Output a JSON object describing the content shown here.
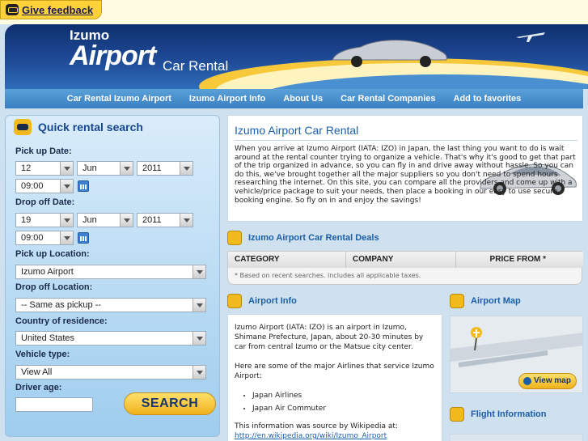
{
  "feedback": {
    "label": "Give feedback"
  },
  "header": {
    "logo_line1": "Izumo",
    "logo_line2": "Airport",
    "logo_line3": "Car Rental"
  },
  "nav": {
    "items": [
      {
        "label": "Car Rental Izumo Airport"
      },
      {
        "label": "Izumo Airport Info"
      },
      {
        "label": "About Us"
      },
      {
        "label": "Car Rental Companies"
      },
      {
        "label": "Add to favorites"
      }
    ]
  },
  "search": {
    "title": "Quick rental search",
    "pickup_date_label": "Pick up Date:",
    "pickup_day": "12",
    "pickup_month": "Jun",
    "pickup_year": "2011",
    "pickup_time": "09:00",
    "dropoff_date_label": "Drop off Date:",
    "dropoff_day": "19",
    "dropoff_month": "Jun",
    "dropoff_year": "2011",
    "dropoff_time": "09:00",
    "pickup_location_label": "Pick up Location:",
    "pickup_location": "Izumo Airport",
    "dropoff_location_label": "Drop off Location:",
    "dropoff_location": "-- Same as pickup --",
    "country_label": "Country of residence:",
    "country": "United States",
    "vehicle_label": "Vehicle type:",
    "vehicle": "View All",
    "driver_age_label": "Driver age:",
    "driver_age": "",
    "button": "SEARCH"
  },
  "main": {
    "title": "Izumo Airport Car Rental",
    "intro": "When you arrive at Izumo Airport (IATA: IZO) in Japan, the last thing you want to do is wait around at the rental counter trying to organize a vehicle. That's why it's good to get that part of the trip organized in advance, so you can fly in and drive away without hassle. So you can do this, we've brought together all the major suppliers so you don't need to spend hours researching the internet. On this site, you can compare all the providers and come up with a vehicle/price package to suit your needs, then place a booking in our easy to use secure booking engine. So fly on in and enjoy the savings!"
  },
  "deals": {
    "title": "Izumo Airport Car Rental Deals",
    "columns": [
      "CATEGORY",
      "COMPANY",
      "PRICE FROM *"
    ],
    "note": "* Based on recent searches. includes all applicable taxes."
  },
  "info": {
    "title": "Airport Info",
    "p1": "Izumo Airport (IATA: IZO) is an airport in Izumo, Shimane Prefecture, Japan, about 20-30 minutes by car from central Izumo or the Matsue city center.",
    "p2": "Here are some of the major Airlines that service Izumo Airport:",
    "airlines": [
      "Japan Airlines",
      "Japan Air Commuter"
    ],
    "p3": "This information was source by Wikipedia at:",
    "link": "http://en.wikipedia.org/wiki/Izumo_Airport"
  },
  "map": {
    "title": "Airport Map",
    "button": "View map"
  },
  "flight": {
    "title": "Flight Information"
  },
  "colors": {
    "accent": "#1d5fa6",
    "nav": "#3a80c2",
    "yellow": "#f1b91c"
  }
}
